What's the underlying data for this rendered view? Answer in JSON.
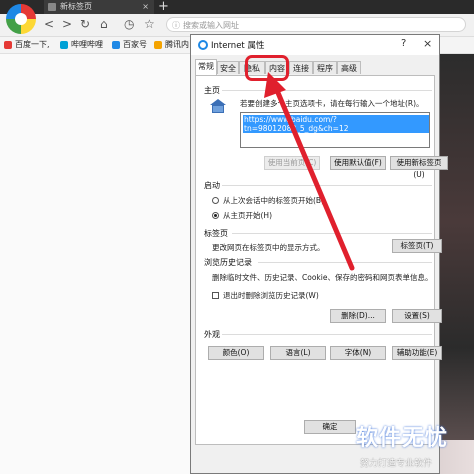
{
  "browser": {
    "tab_title": "新标签页",
    "tab_close": "×",
    "new_tab": "+",
    "address_placeholder": "搜索或输入网址",
    "bookmarks": [
      {
        "label": "百度一下,",
        "color": "#e53935"
      },
      {
        "label": "哔哩哔哩",
        "color": "#00a1d6"
      },
      {
        "label": "百家号",
        "color": "#1e88e5"
      },
      {
        "label": "腾讯内",
        "color": "#f4a300"
      }
    ]
  },
  "dialog": {
    "title": "Internet 属性",
    "help": "?",
    "close": "×",
    "tabs": [
      "常规",
      "安全",
      "隐私",
      "内容",
      "连接",
      "程序",
      "高级"
    ],
    "active_tab": "常规",
    "homepage": {
      "section": "主页",
      "desc": "若要创建多个主页选项卡，请在每行输入一个地址(R)。",
      "url": "https://www.baidu.com/?tn=98012088_5_dg&ch=12",
      "btn_current": "使用当前页(C)",
      "btn_default": "使用默认值(F)",
      "btn_newtab": "使用新标签页(U)"
    },
    "startup": {
      "section": "启动",
      "opt_last": "从上次会话中的标签页开始(B)",
      "opt_home": "从主页开始(H)",
      "selected": "opt_home"
    },
    "tabs_section": {
      "section": "标签页",
      "desc": "更改网页在标签页中的显示方式。",
      "btn": "标签页(T)"
    },
    "history": {
      "section": "浏览历史记录",
      "desc": "删除临时文件、历史记录、Cookie、保存的密码和网页表单信息。",
      "checkbox": "退出时删除浏览历史记录(W)",
      "checked": false,
      "btn_delete": "删除(D)...",
      "btn_settings": "设置(S)"
    },
    "appearance": {
      "section": "外观",
      "btn_colors": "颜色(O)",
      "btn_languages": "语言(L)",
      "btn_fonts": "字体(N)",
      "btn_accessibility": "辅助功能(E)"
    },
    "ok": "确定"
  },
  "watermark": {
    "title": "软件无忧",
    "sub": "努力打造专业软件"
  },
  "colors": {
    "annotation": "#e0202d",
    "selection": "#3399ff"
  }
}
